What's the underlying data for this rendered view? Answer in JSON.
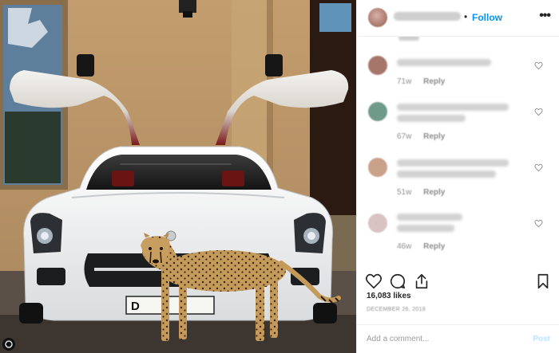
{
  "header": {
    "follow_label": "Follow",
    "separator": "•",
    "more_label": "•••"
  },
  "comments": [
    {
      "time": "71w",
      "reply_label": "Reply",
      "avatar_color": "#a7766b"
    },
    {
      "time": "67w",
      "reply_label": "Reply",
      "avatar_color": "#6f9a8a"
    },
    {
      "time": "51w",
      "reply_label": "Reply",
      "avatar_color": "#c9a088"
    },
    {
      "time": "46w",
      "reply_label": "Reply",
      "avatar_color": "#d8c2c2"
    }
  ],
  "actions": {
    "icons": [
      "heart-icon",
      "comment-icon",
      "share-icon",
      "bookmark-icon"
    ]
  },
  "likes_text": "16,083 likes",
  "date_text": "DECEMBER 26, 2018",
  "add_comment": {
    "placeholder": "Add a comment...",
    "post_label": "Post"
  },
  "photo": {
    "plate_text": "D",
    "scene": "white gull-wing sports car with cheetah"
  },
  "colors": {
    "follow_blue": "#0095f6",
    "meta_gray": "#8e8e8e",
    "wall_tan": "#b58f63"
  }
}
